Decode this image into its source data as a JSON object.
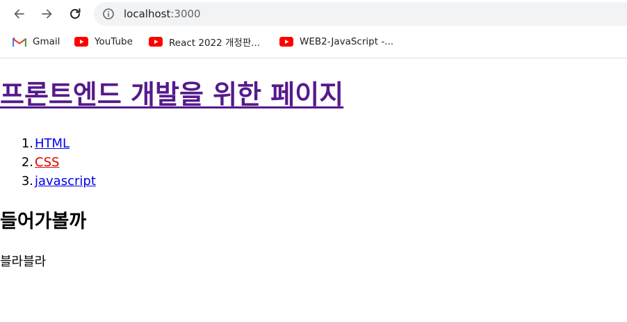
{
  "browser": {
    "url_host": "localhost",
    "url_port": ":3000",
    "bookmarks": [
      {
        "label": "Gmail",
        "icon": "gmail-icon"
      },
      {
        "label": "YouTube",
        "icon": "youtube-icon"
      },
      {
        "label": "React 2022 개정판...",
        "icon": "youtube-icon"
      },
      {
        "label": "WEB2-JavaScript -...",
        "icon": "youtube-icon"
      }
    ],
    "colors": {
      "omnibox_bg": "#f1f3f4",
      "youtube_red": "#ff0000",
      "gmail_red": "#ea4335"
    }
  },
  "page": {
    "title": "프론트엔드 개발을 위한 페이지",
    "topics": [
      {
        "number": "1.",
        "label": "HTML",
        "active": false
      },
      {
        "number": "2.",
        "label": "CSS",
        "active": true
      },
      {
        "number": "3.",
        "label": "javascript",
        "active": false
      }
    ],
    "section_heading": "들어가볼까",
    "body_text": "블라블라",
    "colors": {
      "title_link": "#551a8b",
      "link": "#0000ee",
      "active_link": "#e00000"
    }
  }
}
